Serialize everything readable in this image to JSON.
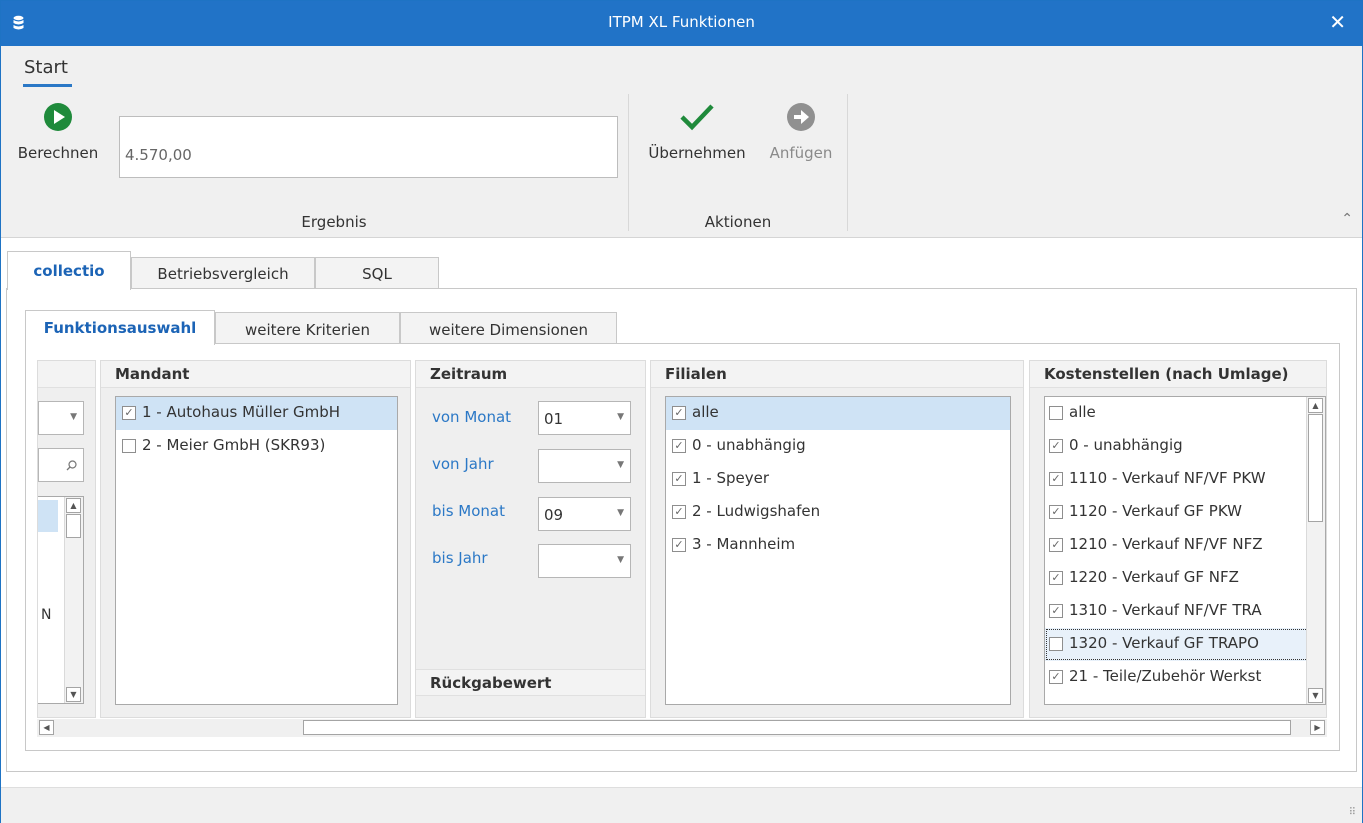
{
  "window": {
    "title": "ITPM XL Funktionen",
    "close_glyph": "✕"
  },
  "ribbon": {
    "tab_label": "Start",
    "calculate_label": "Berechnen",
    "result_value": "4.570,00",
    "result_group_label": "Ergebnis",
    "apply_label": "Übernehmen",
    "append_label": "Anfügen",
    "actions_group_label": "Aktionen",
    "collapse_glyph": "⌃"
  },
  "outer_tabs": [
    "collectio",
    "Betriebsvergleich",
    "SQL"
  ],
  "inner_tabs": [
    "Funktionsauswahl",
    "weitere Kriterien",
    "weitere Dimensionen"
  ],
  "truncated_column": {
    "partial_text": "N"
  },
  "mandant": {
    "header": "Mandant",
    "items": [
      {
        "label": "1 - Autohaus Müller GmbH",
        "checked": true
      },
      {
        "label": "2 - Meier GmbH (SKR93)",
        "checked": false
      }
    ]
  },
  "zeitraum": {
    "header": "Zeitraum",
    "von_monat_label": "von Monat",
    "von_monat_value": "01",
    "von_jahr_label": "von Jahr",
    "von_jahr_value": "",
    "bis_monat_label": "bis Monat",
    "bis_monat_value": "09",
    "bis_jahr_label": "bis Jahr",
    "bis_jahr_value": "",
    "return_header": "Rückgabewert"
  },
  "filialen": {
    "header": "Filialen",
    "items": [
      {
        "label": "alle",
        "checked": true
      },
      {
        "label": "0 - unabhängig",
        "checked": true
      },
      {
        "label": "1 - Speyer",
        "checked": true
      },
      {
        "label": "2 - Ludwigshafen",
        "checked": true
      },
      {
        "label": "3 - Mannheim",
        "checked": true
      }
    ]
  },
  "kostenstellen": {
    "header": "Kostenstellen (nach Umlage)",
    "items": [
      {
        "label": "alle",
        "checked": false
      },
      {
        "label": "0 - unabhängig",
        "checked": true
      },
      {
        "label": "1110 - Verkauf NF/VF PKW",
        "checked": true
      },
      {
        "label": "1120 - Verkauf GF PKW",
        "checked": true
      },
      {
        "label": "1210 - Verkauf NF/VF NFZ",
        "checked": true
      },
      {
        "label": "1220 - Verkauf GF NFZ",
        "checked": true
      },
      {
        "label": "1310 - Verkauf NF/VF TRA",
        "checked": true
      },
      {
        "label": "1320 - Verkauf GF TRAPO",
        "checked": false
      },
      {
        "label": "21 - Teile/Zubehör Werkst",
        "checked": true
      }
    ]
  },
  "icons": {
    "app": "database-icon",
    "calculate": "play-circle-icon",
    "apply": "checkmark-icon",
    "append": "arrow-right-circle-icon",
    "search": "magnifier-icon"
  },
  "colors": {
    "titlebar": "#2173c7",
    "accent": "#1c64b6",
    "play": "#1f8a3b",
    "check": "#1f8a3b"
  }
}
